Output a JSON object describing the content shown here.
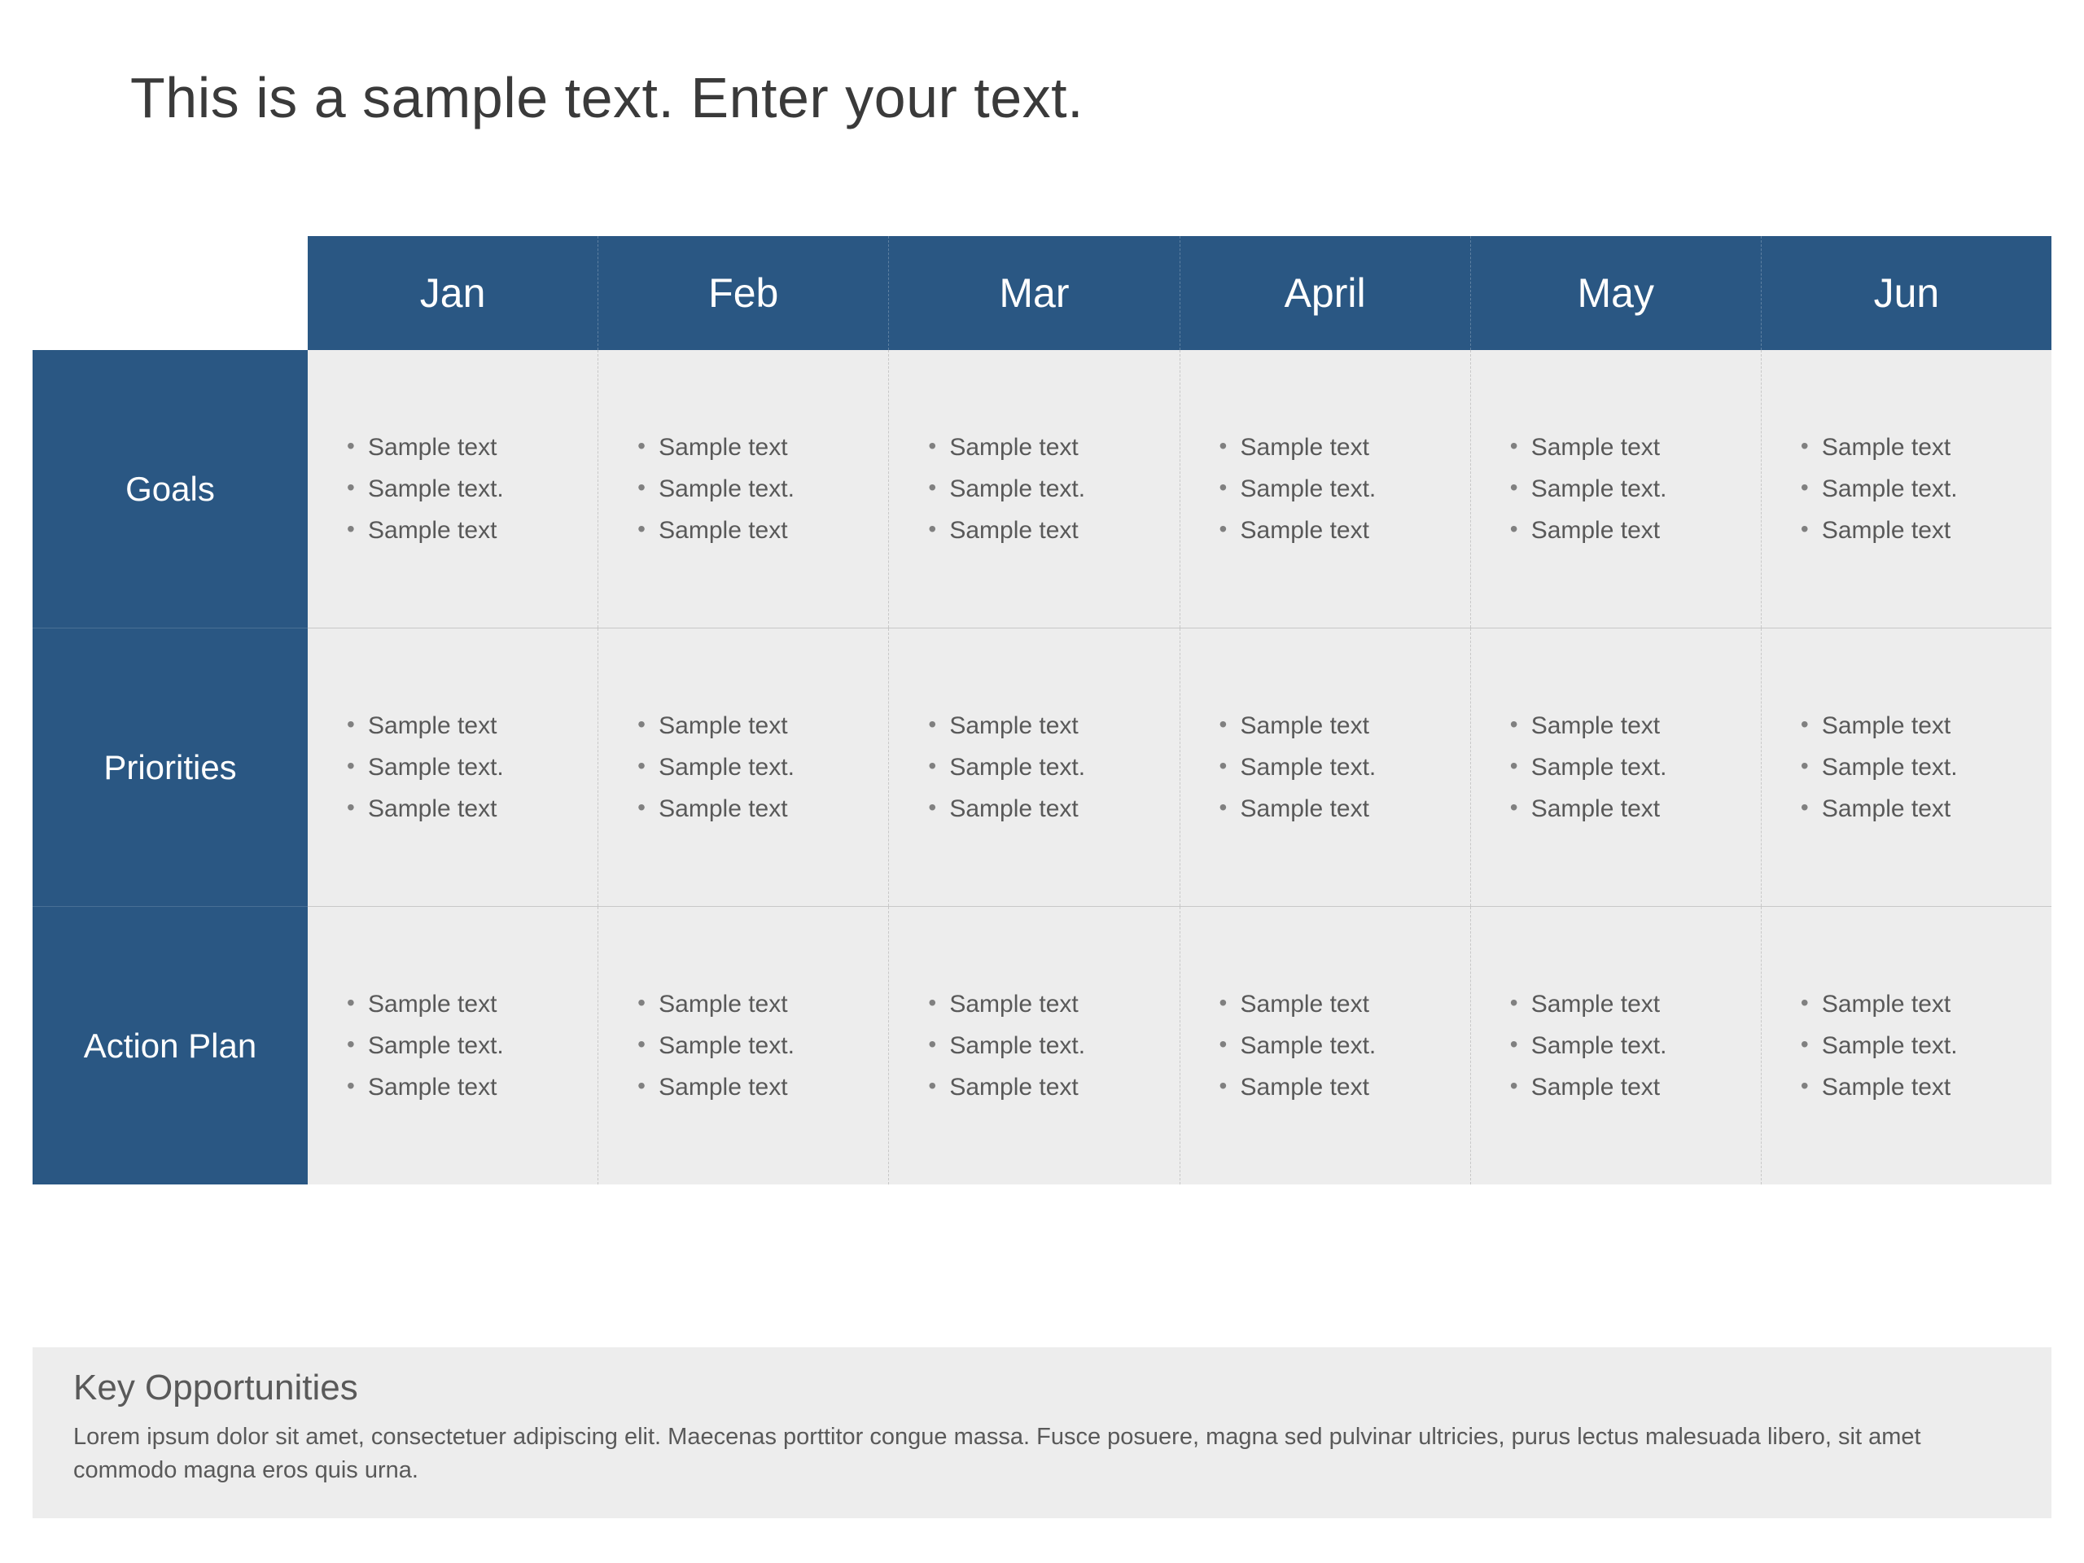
{
  "title": "This is a sample text. Enter your text.",
  "months": [
    "Jan",
    "Feb",
    "Mar",
    "April",
    "May",
    "Jun"
  ],
  "rows": [
    {
      "label": "Goals",
      "cells": [
        [
          "Sample text",
          "Sample text.",
          "Sample text"
        ],
        [
          "Sample text",
          "Sample text.",
          "Sample text"
        ],
        [
          "Sample text",
          "Sample text.",
          "Sample text"
        ],
        [
          "Sample text",
          "Sample text.",
          "Sample text"
        ],
        [
          "Sample text",
          "Sample text.",
          "Sample text"
        ],
        [
          "Sample text",
          "Sample text.",
          "Sample text"
        ]
      ]
    },
    {
      "label": "Priorities",
      "cells": [
        [
          "Sample text",
          "Sample text.",
          "Sample text"
        ],
        [
          "Sample text",
          "Sample text.",
          "Sample text"
        ],
        [
          "Sample text",
          "Sample text.",
          "Sample text"
        ],
        [
          "Sample text",
          "Sample text.",
          "Sample text"
        ],
        [
          "Sample text",
          "Sample text.",
          "Sample text"
        ],
        [
          "Sample text",
          "Sample text.",
          "Sample text"
        ]
      ]
    },
    {
      "label": "Action Plan",
      "cells": [
        [
          "Sample text",
          "Sample text.",
          "Sample text"
        ],
        [
          "Sample text",
          "Sample text.",
          "Sample text"
        ],
        [
          "Sample text",
          "Sample text.",
          "Sample text"
        ],
        [
          "Sample text",
          "Sample text.",
          "Sample text"
        ],
        [
          "Sample text",
          "Sample text.",
          "Sample text"
        ],
        [
          "Sample text",
          "Sample text.",
          "Sample text"
        ]
      ]
    }
  ],
  "key": {
    "title": "Key Opportunities",
    "body": "Lorem ipsum dolor sit amet, consectetuer adipiscing elit. Maecenas porttitor congue massa. Fusce posuere, magna sed pulvinar ultricies, purus lectus malesuada libero, sit amet commodo magna eros quis urna."
  },
  "colors": {
    "accent": "#2a5783",
    "cellBg": "#ededed"
  }
}
